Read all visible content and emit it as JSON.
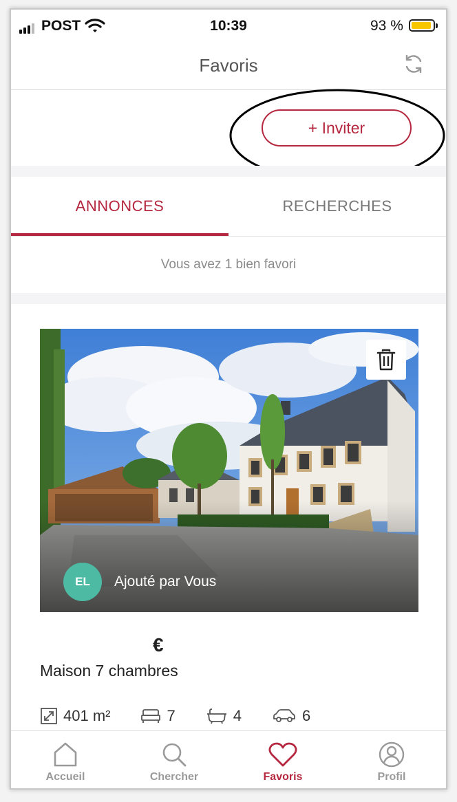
{
  "status_bar": {
    "carrier": "POST",
    "time": "10:39",
    "battery_percent": "93 %",
    "battery_level": 0.93,
    "signal_bars": 3
  },
  "header": {
    "title": "Favoris",
    "refresh_icon": "refresh-icon"
  },
  "invite": {
    "label": "+ Inviter"
  },
  "tabs": [
    {
      "label": "ANNONCES",
      "active": true
    },
    {
      "label": "RECHERCHES",
      "active": false
    }
  ],
  "favorites_count_text": "Vous avez 1 bien favori",
  "listing": {
    "added_by_initials": "EL",
    "added_by_text": "Ajouté par Vous",
    "price_currency": "€",
    "title": "Maison 7 chambres",
    "features": {
      "surface": "401 m²",
      "bedrooms": "7",
      "bathrooms": "4",
      "parking": "6"
    }
  },
  "bottom_nav": [
    {
      "label": "Accueil",
      "icon": "home-icon",
      "active": false
    },
    {
      "label": "Chercher",
      "icon": "search-icon",
      "active": false
    },
    {
      "label": "Favoris",
      "icon": "heart-icon",
      "active": true
    },
    {
      "label": "Profil",
      "icon": "profile-icon",
      "active": false
    }
  ],
  "colors": {
    "accent": "#b5283f",
    "avatar": "#4dbba4",
    "battery": "#f7c600"
  }
}
